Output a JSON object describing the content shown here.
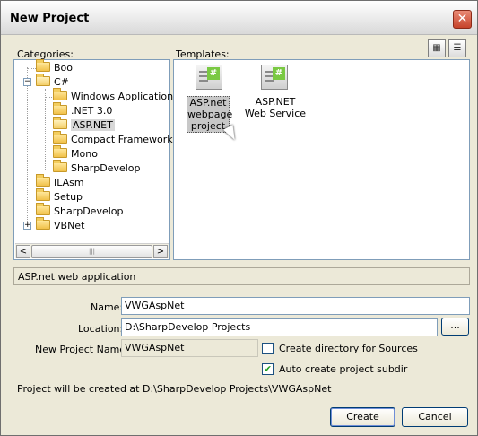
{
  "window": {
    "title": "New Project",
    "close_label": "✕"
  },
  "categories": {
    "label": "Categories:",
    "items": [
      {
        "label": "Boo"
      },
      {
        "label": "C#"
      },
      {
        "label": "Windows Applications"
      },
      {
        "label": ".NET 3.0"
      },
      {
        "label": "ASP.NET"
      },
      {
        "label": "Compact Framework"
      },
      {
        "label": "Mono"
      },
      {
        "label": "SharpDevelop"
      },
      {
        "label": "ILAsm"
      },
      {
        "label": "Setup"
      },
      {
        "label": "SharpDevelop"
      },
      {
        "label": "VBNet"
      }
    ],
    "expanders": {
      "csharp": "−",
      "vbnet": "+"
    }
  },
  "scrollbar": {
    "left_arrow": "<",
    "right_arrow": ">",
    "thumb_grip": "|||"
  },
  "templates": {
    "label": "Templates:",
    "items": [
      {
        "label": "ASP.net webpage project",
        "line1": "ASP.net",
        "line2": "webpage",
        "line3": "project"
      },
      {
        "label": "ASP.NET Web Service",
        "line1": "ASP.NET",
        "line2": "Web Service"
      }
    ],
    "view_large": "▦",
    "view_list": "☰"
  },
  "description": "ASP.net web application",
  "form": {
    "name_label": "Name:",
    "name_value": "VWGAspNet",
    "location_label": "Location:",
    "location_value": "D:\\SharpDevelop Projects",
    "browse_label": "...",
    "new_project_name_label": "New Project Name:",
    "new_project_name_value": "VWGAspNet",
    "create_dir_label": "Create directory for Sources",
    "auto_subdir_label": "Auto create project subdir",
    "check_mark": "✔",
    "path_info": "Project will be created at D:\\SharpDevelop Projects\\VWGAspNet"
  },
  "buttons": {
    "create": "Create",
    "cancel": "Cancel"
  },
  "icons": {
    "template_hash": "#"
  },
  "colors": {
    "accent_border": "#7f9db9",
    "check_green": "#21a121"
  }
}
